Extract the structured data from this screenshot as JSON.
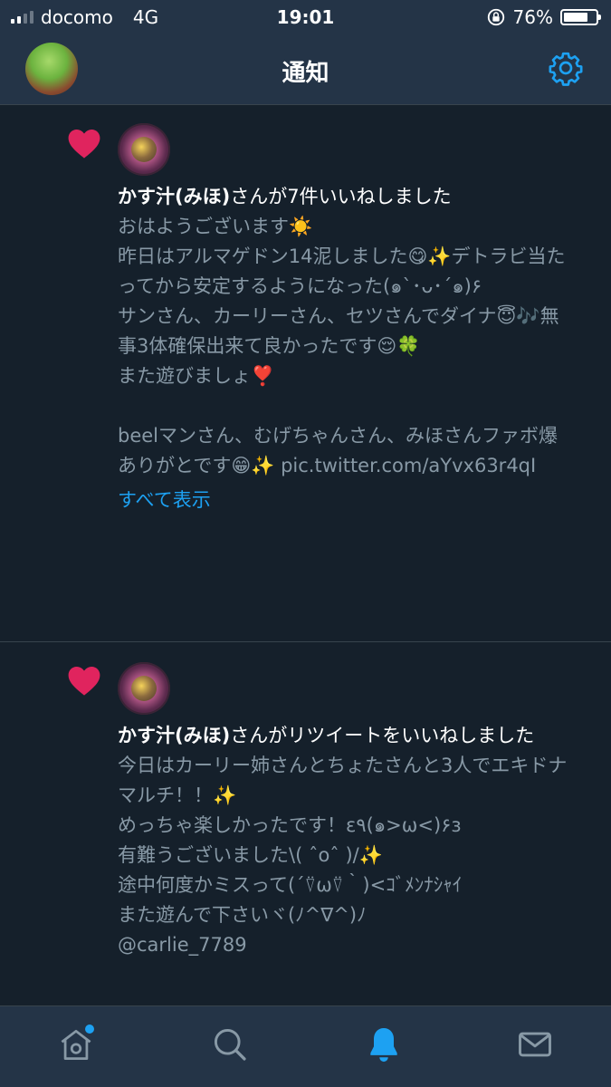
{
  "status_bar": {
    "carrier": "docomo",
    "network": "4G",
    "time": "19:01",
    "battery_percent_label": "76%",
    "battery_level": 0.76
  },
  "header": {
    "title": "通知"
  },
  "notifications": [
    {
      "user": "かす汁(みほ)",
      "action": "さんが7件いいねしました",
      "text": "おはようございます☀️\n昨日はアルマゲドン14泥しました😋✨デトラビ当たってから安定するようになった(๑`･ᴗ･´๑)۶\nサンさん、カーリーさん、セツさんでダイナ😇🎶無事3体確保出来て良かったです😌🍀\nまた遊びましょ❣️\n\nbeelマンさん、むげちゃんさん、みほさんファボ爆ありがとです😁✨ pic.twitter.com/aYvx63r4qI",
      "show_all": "すべて表示"
    },
    {
      "user": "かす汁(みほ)",
      "action": "さんがリツイートをいいねしました",
      "text": "今日はカーリー姉さんとちょたさんと3人でエキドナマルチ！！✨\nめっちゃ楽しかったです！ε٩(๑>ω<)۶з\n有難うございました\\( ˆoˆ )/✨\n途中何度かミスって(´⍢ω⍢｀)<ｺﾞﾒﾝﾅｼｬｲ\nまた遊んで下さいヾ(ﾉ^∇^)ﾉ\n@carlie_7789"
    }
  ],
  "tabs": [
    "home",
    "search",
    "notifications",
    "messages"
  ],
  "colors": {
    "accent": "#1da1f2",
    "like": "#e0245e",
    "background": "#15202b",
    "bar": "#243447",
    "secondary_text": "#8899a6"
  }
}
